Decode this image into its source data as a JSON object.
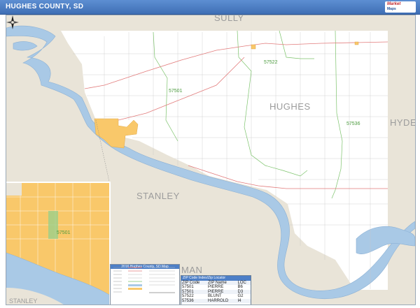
{
  "header": {
    "title": "HUGHES COUNTY, SD",
    "logo_line1": "Market",
    "logo_line2": "Maps"
  },
  "map": {
    "county_labels": {
      "main": "HUGHES",
      "north": "SULLY",
      "east": "HYDE",
      "southwest": "STANLEY",
      "south": "MAN",
      "inset_stanley": "STANLEY"
    },
    "zip_labels": {
      "z57522": "57522",
      "z57501": "57501",
      "z57536": "57536",
      "inset_57501": "57501"
    },
    "colors": {
      "land_neighbor": "#e9e4d8",
      "county_fill": "#ffffff",
      "water": "#a9c9e6",
      "zip_boundary": "#7cc36b",
      "city_fill": "#f9c86a",
      "highway": "#e27b7b"
    }
  },
  "legend": {
    "title": "2016 Hughes County, SD Map"
  },
  "zip_table": {
    "title": "ZIP Code Index/Zip Locator",
    "headers": [
      "ZIP Code",
      "ZIP Name",
      "LOC"
    ],
    "rows": [
      [
        "57501",
        "PIERRE",
        "B6"
      ],
      [
        "57501",
        "PIERRE",
        "D3"
      ],
      [
        "57522",
        "BLUNT",
        "G2"
      ],
      [
        "57536",
        "HARROLD",
        "I4"
      ]
    ]
  }
}
